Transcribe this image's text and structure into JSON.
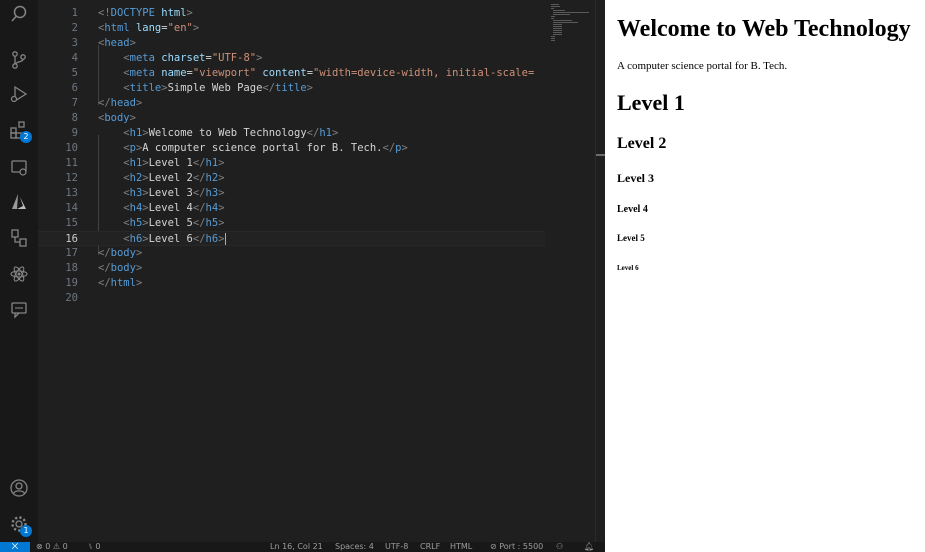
{
  "activity_bar": {
    "extensions_badge": "2",
    "manage_badge": "1"
  },
  "editor": {
    "lines": [
      {
        "num": "1",
        "code": [
          [
            "tag",
            "<!"
          ],
          [
            "name",
            "DOCTYPE"
          ],
          [
            "txt",
            " "
          ],
          [
            "attr",
            "html"
          ],
          [
            "tag",
            ">"
          ]
        ]
      },
      {
        "num": "2",
        "code": [
          [
            "tag",
            "<"
          ],
          [
            "name",
            "html"
          ],
          [
            "txt",
            " "
          ],
          [
            "attr",
            "lang"
          ],
          [
            "txt",
            "="
          ],
          [
            "str",
            "\"en\""
          ],
          [
            "tag",
            ">"
          ]
        ]
      },
      {
        "num": "3",
        "code": [
          [
            "tag",
            "<"
          ],
          [
            "name",
            "head"
          ],
          [
            "tag",
            ">"
          ]
        ]
      },
      {
        "num": "4",
        "code": [
          [
            "txt",
            "    "
          ],
          [
            "tag",
            "<"
          ],
          [
            "name",
            "meta"
          ],
          [
            "txt",
            " "
          ],
          [
            "attr",
            "charset"
          ],
          [
            "txt",
            "="
          ],
          [
            "str",
            "\"UTF-8\""
          ],
          [
            "tag",
            ">"
          ]
        ]
      },
      {
        "num": "5",
        "code": [
          [
            "txt",
            "    "
          ],
          [
            "tag",
            "<"
          ],
          [
            "name",
            "meta"
          ],
          [
            "txt",
            " "
          ],
          [
            "attr",
            "name"
          ],
          [
            "txt",
            "="
          ],
          [
            "str",
            "\"viewport\""
          ],
          [
            "txt",
            " "
          ],
          [
            "attr",
            "content"
          ],
          [
            "txt",
            "="
          ],
          [
            "str",
            "\"width=device-width, initial-scale="
          ]
        ]
      },
      {
        "num": "6",
        "code": [
          [
            "txt",
            "    "
          ],
          [
            "tag",
            "<"
          ],
          [
            "name",
            "title"
          ],
          [
            "tag",
            ">"
          ],
          [
            "txt",
            "Simple Web Page"
          ],
          [
            "tag",
            "</"
          ],
          [
            "name",
            "title"
          ],
          [
            "tag",
            ">"
          ]
        ]
      },
      {
        "num": "7",
        "code": [
          [
            "tag",
            "</"
          ],
          [
            "name",
            "head"
          ],
          [
            "tag",
            ">"
          ]
        ]
      },
      {
        "num": "8",
        "code": [
          [
            "tag",
            "<"
          ],
          [
            "name",
            "body"
          ],
          [
            "tag",
            ">"
          ]
        ]
      },
      {
        "num": "9",
        "code": [
          [
            "txt",
            "    "
          ],
          [
            "tag",
            "<"
          ],
          [
            "name",
            "h1"
          ],
          [
            "tag",
            ">"
          ],
          [
            "txt",
            "Welcome to Web Technology"
          ],
          [
            "tag",
            "</"
          ],
          [
            "name",
            "h1"
          ],
          [
            "tag",
            ">"
          ]
        ]
      },
      {
        "num": "10",
        "code": [
          [
            "txt",
            "    "
          ],
          [
            "tag",
            "<"
          ],
          [
            "name",
            "p"
          ],
          [
            "tag",
            ">"
          ],
          [
            "txt",
            "A computer science portal for B. Tech."
          ],
          [
            "tag",
            "</"
          ],
          [
            "name",
            "p"
          ],
          [
            "tag",
            ">"
          ]
        ]
      },
      {
        "num": "11",
        "code": [
          [
            "txt",
            "    "
          ],
          [
            "tag",
            "<"
          ],
          [
            "name",
            "h1"
          ],
          [
            "tag",
            ">"
          ],
          [
            "txt",
            "Level 1"
          ],
          [
            "tag",
            "</"
          ],
          [
            "name",
            "h1"
          ],
          [
            "tag",
            ">"
          ]
        ]
      },
      {
        "num": "12",
        "code": [
          [
            "txt",
            "    "
          ],
          [
            "tag",
            "<"
          ],
          [
            "name",
            "h2"
          ],
          [
            "tag",
            ">"
          ],
          [
            "txt",
            "Level 2"
          ],
          [
            "tag",
            "</"
          ],
          [
            "name",
            "h2"
          ],
          [
            "tag",
            ">"
          ]
        ]
      },
      {
        "num": "13",
        "code": [
          [
            "txt",
            "    "
          ],
          [
            "tag",
            "<"
          ],
          [
            "name",
            "h3"
          ],
          [
            "tag",
            ">"
          ],
          [
            "txt",
            "Level 3"
          ],
          [
            "tag",
            "</"
          ],
          [
            "name",
            "h3"
          ],
          [
            "tag",
            ">"
          ]
        ]
      },
      {
        "num": "14",
        "code": [
          [
            "txt",
            "    "
          ],
          [
            "tag",
            "<"
          ],
          [
            "name",
            "h4"
          ],
          [
            "tag",
            ">"
          ],
          [
            "txt",
            "Level 4"
          ],
          [
            "tag",
            "</"
          ],
          [
            "name",
            "h4"
          ],
          [
            "tag",
            ">"
          ]
        ]
      },
      {
        "num": "15",
        "code": [
          [
            "txt",
            "    "
          ],
          [
            "tag",
            "<"
          ],
          [
            "name",
            "h5"
          ],
          [
            "tag",
            ">"
          ],
          [
            "txt",
            "Level 5"
          ],
          [
            "tag",
            "</"
          ],
          [
            "name",
            "h5"
          ],
          [
            "tag",
            ">"
          ]
        ]
      },
      {
        "num": "16",
        "code": [
          [
            "txt",
            "    "
          ],
          [
            "tag",
            "<"
          ],
          [
            "name",
            "h6"
          ],
          [
            "tag",
            ">"
          ],
          [
            "txt",
            "Level 6"
          ],
          [
            "tag",
            "</"
          ],
          [
            "name",
            "h6"
          ],
          [
            "tag",
            ">"
          ]
        ],
        "current": true
      },
      {
        "num": "17",
        "code": [
          [
            "tag",
            "</"
          ],
          [
            "name",
            "body"
          ],
          [
            "tag",
            ">"
          ]
        ]
      },
      {
        "num": "18",
        "code": [
          [
            "tag",
            "</"
          ],
          [
            "name",
            "body"
          ],
          [
            "tag",
            ">"
          ]
        ]
      },
      {
        "num": "19",
        "code": [
          [
            "tag",
            "</"
          ],
          [
            "name",
            "html"
          ],
          [
            "tag",
            ">"
          ]
        ]
      },
      {
        "num": "20",
        "code": []
      }
    ]
  },
  "preview": {
    "h1": "Welcome to Web Technology",
    "p": "A computer science portal for B. Tech.",
    "level1": "Level 1",
    "level2": "Level 2",
    "level3": "Level 3",
    "level4": "Level 4",
    "level5": "Level 5",
    "level6": "Level 6"
  },
  "status_bar": {
    "problems": "⊗ 0 ⚠ 0",
    "ports": "⑊ 0",
    "cursor_pos": "Ln 16, Col 21",
    "spaces": "Spaces: 4",
    "encoding": "UTF-8",
    "eol": "CRLF",
    "language": "HTML",
    "live_server": "⊘ Port : 5500"
  },
  "colors": {
    "accent": "#0078d4",
    "editor_bg": "#1f1f1f",
    "activity_bg": "#181818"
  }
}
